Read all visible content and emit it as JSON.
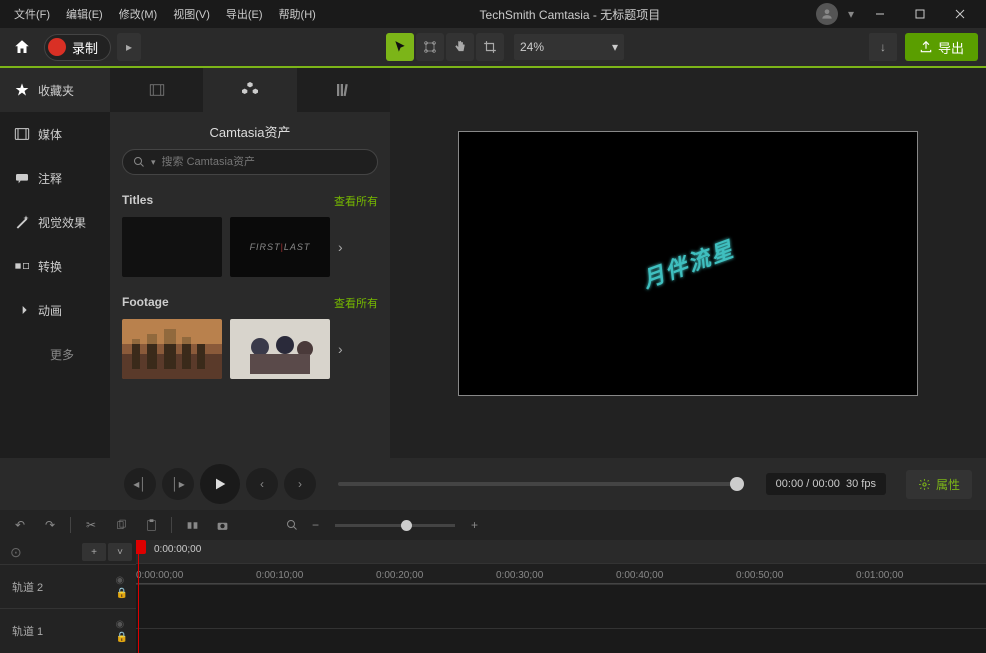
{
  "titlebar": {
    "menus": [
      "文件(F)",
      "编辑(E)",
      "修改(M)",
      "视图(V)",
      "导出(E)",
      "帮助(H)"
    ],
    "title": "TechSmith Camtasia - 无标题项目"
  },
  "toolbar": {
    "record_label": "录制",
    "zoom_value": "24%",
    "export_label": "导出"
  },
  "sidebar": {
    "items": [
      {
        "icon": "star",
        "label": "收藏夹"
      },
      {
        "icon": "media",
        "label": "媒体"
      },
      {
        "icon": "annotation",
        "label": "注释"
      },
      {
        "icon": "effects",
        "label": "视觉效果"
      },
      {
        "icon": "transition",
        "label": "转换"
      },
      {
        "icon": "animation",
        "label": "动画"
      }
    ],
    "more_label": "更多"
  },
  "assets": {
    "panel_title": "Camtasia资产",
    "search_placeholder": "搜索 Camtasia资产",
    "sections": [
      {
        "title": "Titles",
        "view_all": "查看所有"
      },
      {
        "title": "Footage",
        "view_all": "查看所有"
      }
    ],
    "firstlast": "FIRST|LAST"
  },
  "canvas": {
    "text": "月伴流星"
  },
  "player": {
    "time": "00:00 / 00:00",
    "fps": "30 fps",
    "properties_label": "属性"
  },
  "timeline": {
    "playhead_time": "0:00:00;00",
    "ticks": [
      "0:00:00;00",
      "0:00:10;00",
      "0:00:20;00",
      "0:00:30;00",
      "0:00:40;00",
      "0:00:50;00",
      "0:01:00;00"
    ],
    "tracks": [
      "轨道 2",
      "轨道 1"
    ]
  }
}
